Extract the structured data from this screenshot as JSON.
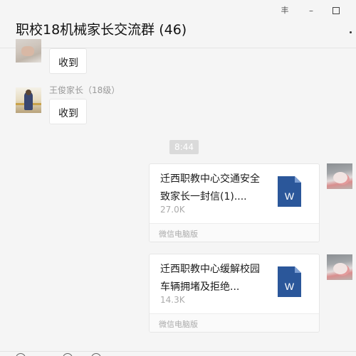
{
  "window": {
    "title": "职校18机械家长交流群 (46)",
    "controls": {
      "pin_glyph": "丰",
      "minimize_glyph": "–"
    }
  },
  "messages": [
    {
      "direction": "received",
      "avatar_icon": "user-avatar-icon",
      "text": "收到"
    },
    {
      "direction": "received",
      "sender": "王俊家长（18级）",
      "avatar_icon": "user-avatar-icon",
      "text": "收到"
    }
  ],
  "time_divider": "8:44",
  "files": [
    {
      "direction": "sent",
      "name": "迁西职教中心交通安全致家长一封信(1)....",
      "size": "27.0K",
      "source": "微信电脑版",
      "file_icon": "word-doc-icon",
      "icon_letter": "W",
      "icon_color": "#2b579a"
    },
    {
      "direction": "sent",
      "name": "迁西职教中心缓解校园车辆拥堵及拒绝...",
      "size": "14.3K",
      "source": "微信电脑版",
      "file_icon": "word-doc-icon",
      "icon_letter": "W",
      "icon_color": "#2b579a"
    }
  ],
  "colors": {
    "background": "#f5f5f5",
    "bubble": "#ffffff",
    "muted_text": "#999999",
    "time_pill": "#dadada"
  }
}
